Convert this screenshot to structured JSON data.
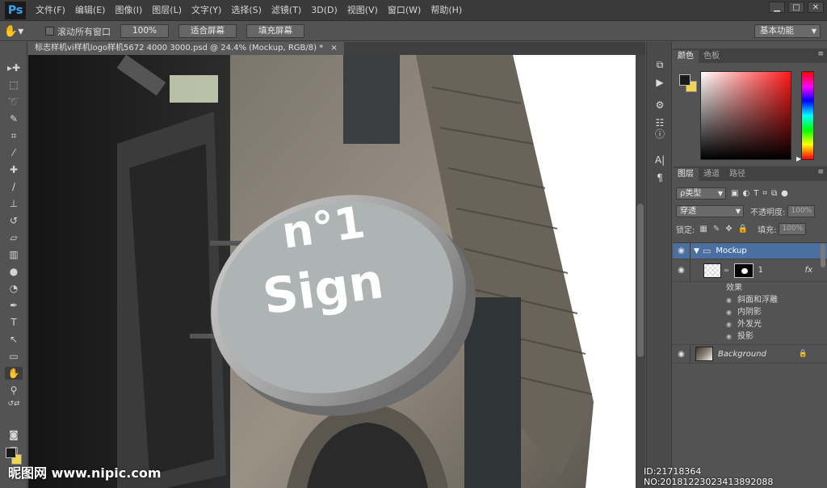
{
  "app": {
    "logo": "Ps"
  },
  "menu": [
    "文件(F)",
    "编辑(E)",
    "图像(I)",
    "图层(L)",
    "文字(Y)",
    "选择(S)",
    "滤镜(T)",
    "3D(D)",
    "视图(V)",
    "窗口(W)",
    "帮助(H)"
  ],
  "window_buttons": {
    "minimize": "▁",
    "restore": "□",
    "close": "✕"
  },
  "options": {
    "scroll_all_label": "滚动所有窗口",
    "btn_100": "100%",
    "btn_fit": "适合屏幕",
    "btn_fill": "填充屏幕",
    "workspace": "基本功能"
  },
  "document": {
    "tab_title": "标志样机vi样机logo样机5672 4000 3000.psd @ 24.4% (Mockup, RGB/8) *",
    "close": "×"
  },
  "sign": {
    "line1": "n°1",
    "line2": "Sign"
  },
  "colors": {
    "foreground": "#1a1a1a",
    "background": "#f5d64a",
    "accent": "#31a8ff",
    "selected_layer": "#4a6fa0"
  },
  "color_panel": {
    "tabs": [
      "颜色",
      "色板"
    ]
  },
  "layers_panel": {
    "tabs": [
      "图层",
      "通道",
      "路径"
    ],
    "filter_kind": "ρ类型",
    "blend_mode": "穿透",
    "opacity_label": "不透明度:",
    "opacity_value": "100%",
    "lock_label": "锁定:",
    "fill_label": "填充:",
    "fill_value": "100%",
    "layers": {
      "group": "Mockup",
      "smart": "1",
      "fx": "fx",
      "effects_label": "效果",
      "effects": [
        "斜面和浮雕",
        "内阴影",
        "外发光",
        "投影"
      ],
      "background": "Background"
    }
  },
  "watermark": {
    "left": "昵图网 www.nipic.com",
    "right": "ID:21718364 NO:20181223023413892088"
  }
}
